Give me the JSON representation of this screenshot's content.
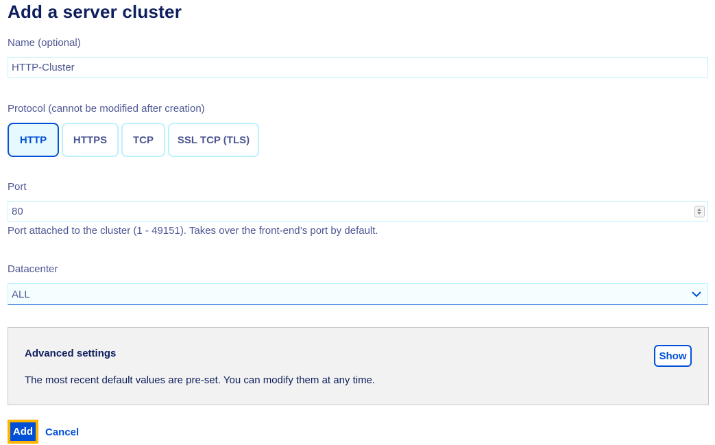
{
  "page": {
    "title": "Add a server cluster"
  },
  "name_field": {
    "label": "Name (optional)",
    "value": "HTTP-Cluster"
  },
  "protocol": {
    "label": "Protocol (cannot be modified after creation)",
    "options": [
      "HTTP",
      "HTTPS",
      "TCP",
      "SSL TCP (TLS)"
    ],
    "selected": "HTTP"
  },
  "port_field": {
    "label": "Port",
    "value": "80",
    "help": "Port attached to the cluster (1 - 49151). Takes over the front-end’s port by default."
  },
  "datacenter": {
    "label": "Datacenter",
    "value": "ALL"
  },
  "advanced": {
    "title": "Advanced settings",
    "text": "The most recent default values are pre-set. You can modify them at any time.",
    "show_label": "Show"
  },
  "actions": {
    "add_label": "Add",
    "cancel_label": "Cancel"
  },
  "colors": {
    "accent": "#0050d7",
    "title": "#0d1e5c",
    "border": "#bef1ff",
    "focus": "#ffb400"
  }
}
